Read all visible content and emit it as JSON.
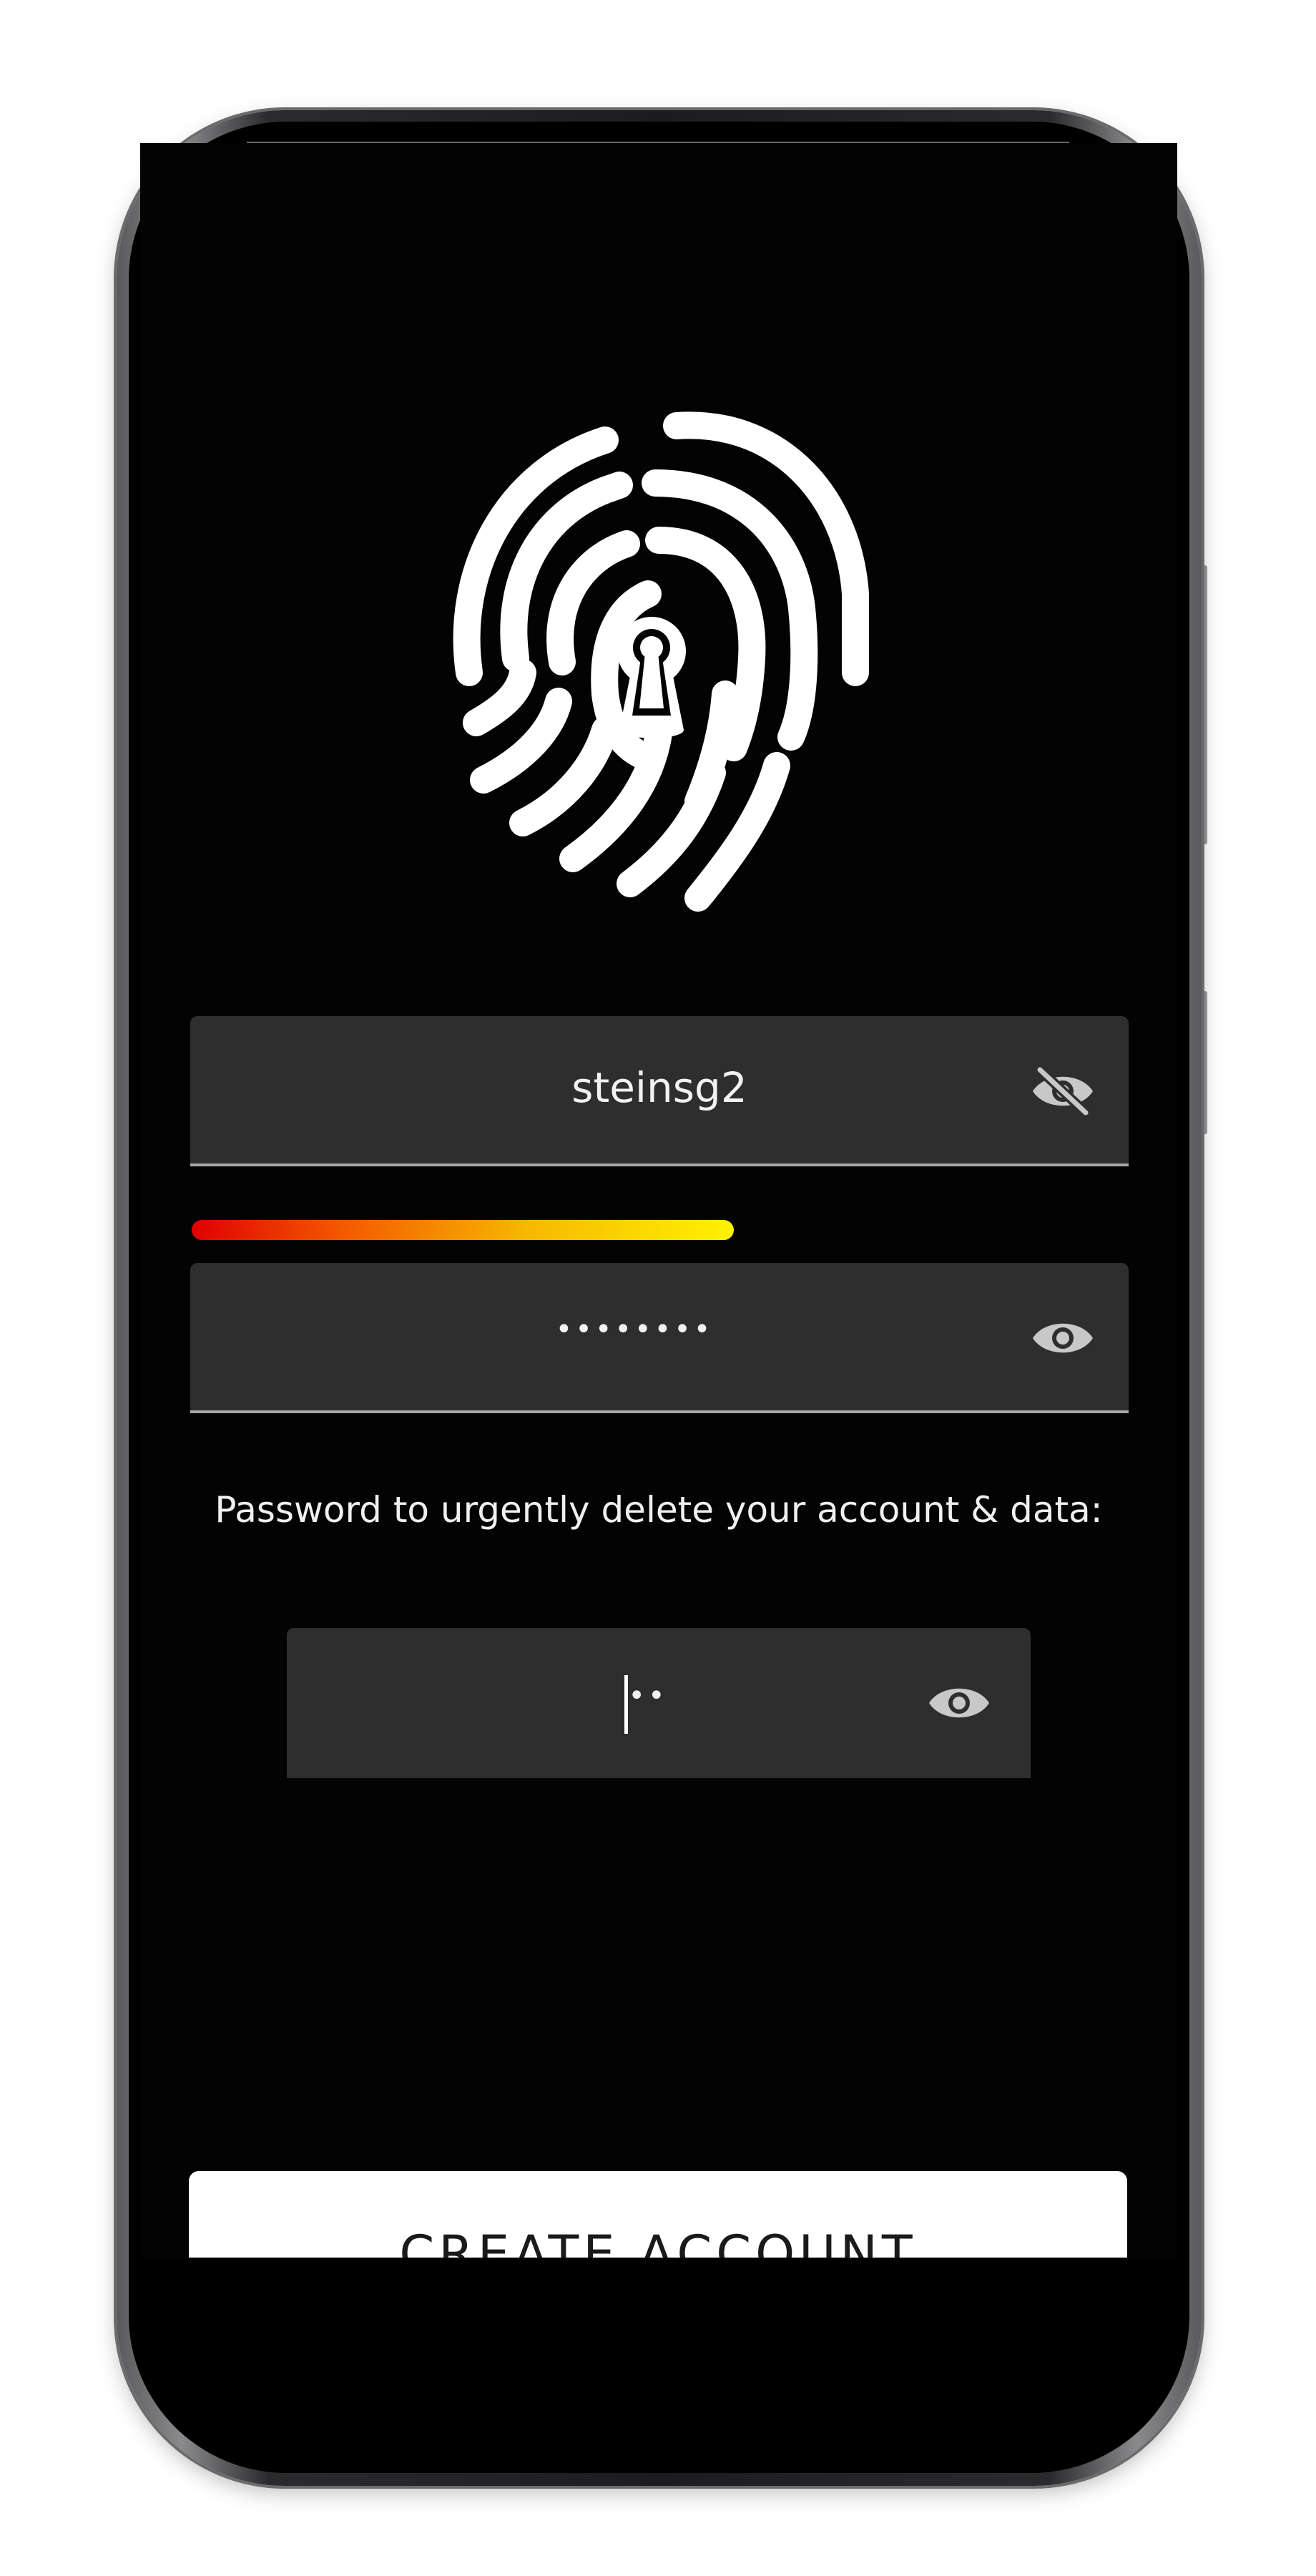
{
  "screen": {
    "username_field": {
      "value": "steinsg2",
      "icon": "eye-off-icon"
    },
    "password_field": {
      "masked_value": "••••••••",
      "icon": "eye-icon",
      "strength_fraction": 0.58,
      "strength_colors": [
        "#e00000",
        "#f35a00",
        "#f7b800",
        "#fff200"
      ]
    },
    "delete_password": {
      "label": "Password to urgently delete your account & data:",
      "masked_value": "••",
      "icon": "eye-icon"
    },
    "create_button": {
      "label": "CREATE ACCOUNT"
    }
  },
  "colors": {
    "background": "#030303",
    "field": "#2e2e2e",
    "text": "#f2f2f2",
    "icon": "#c8c8c8"
  }
}
